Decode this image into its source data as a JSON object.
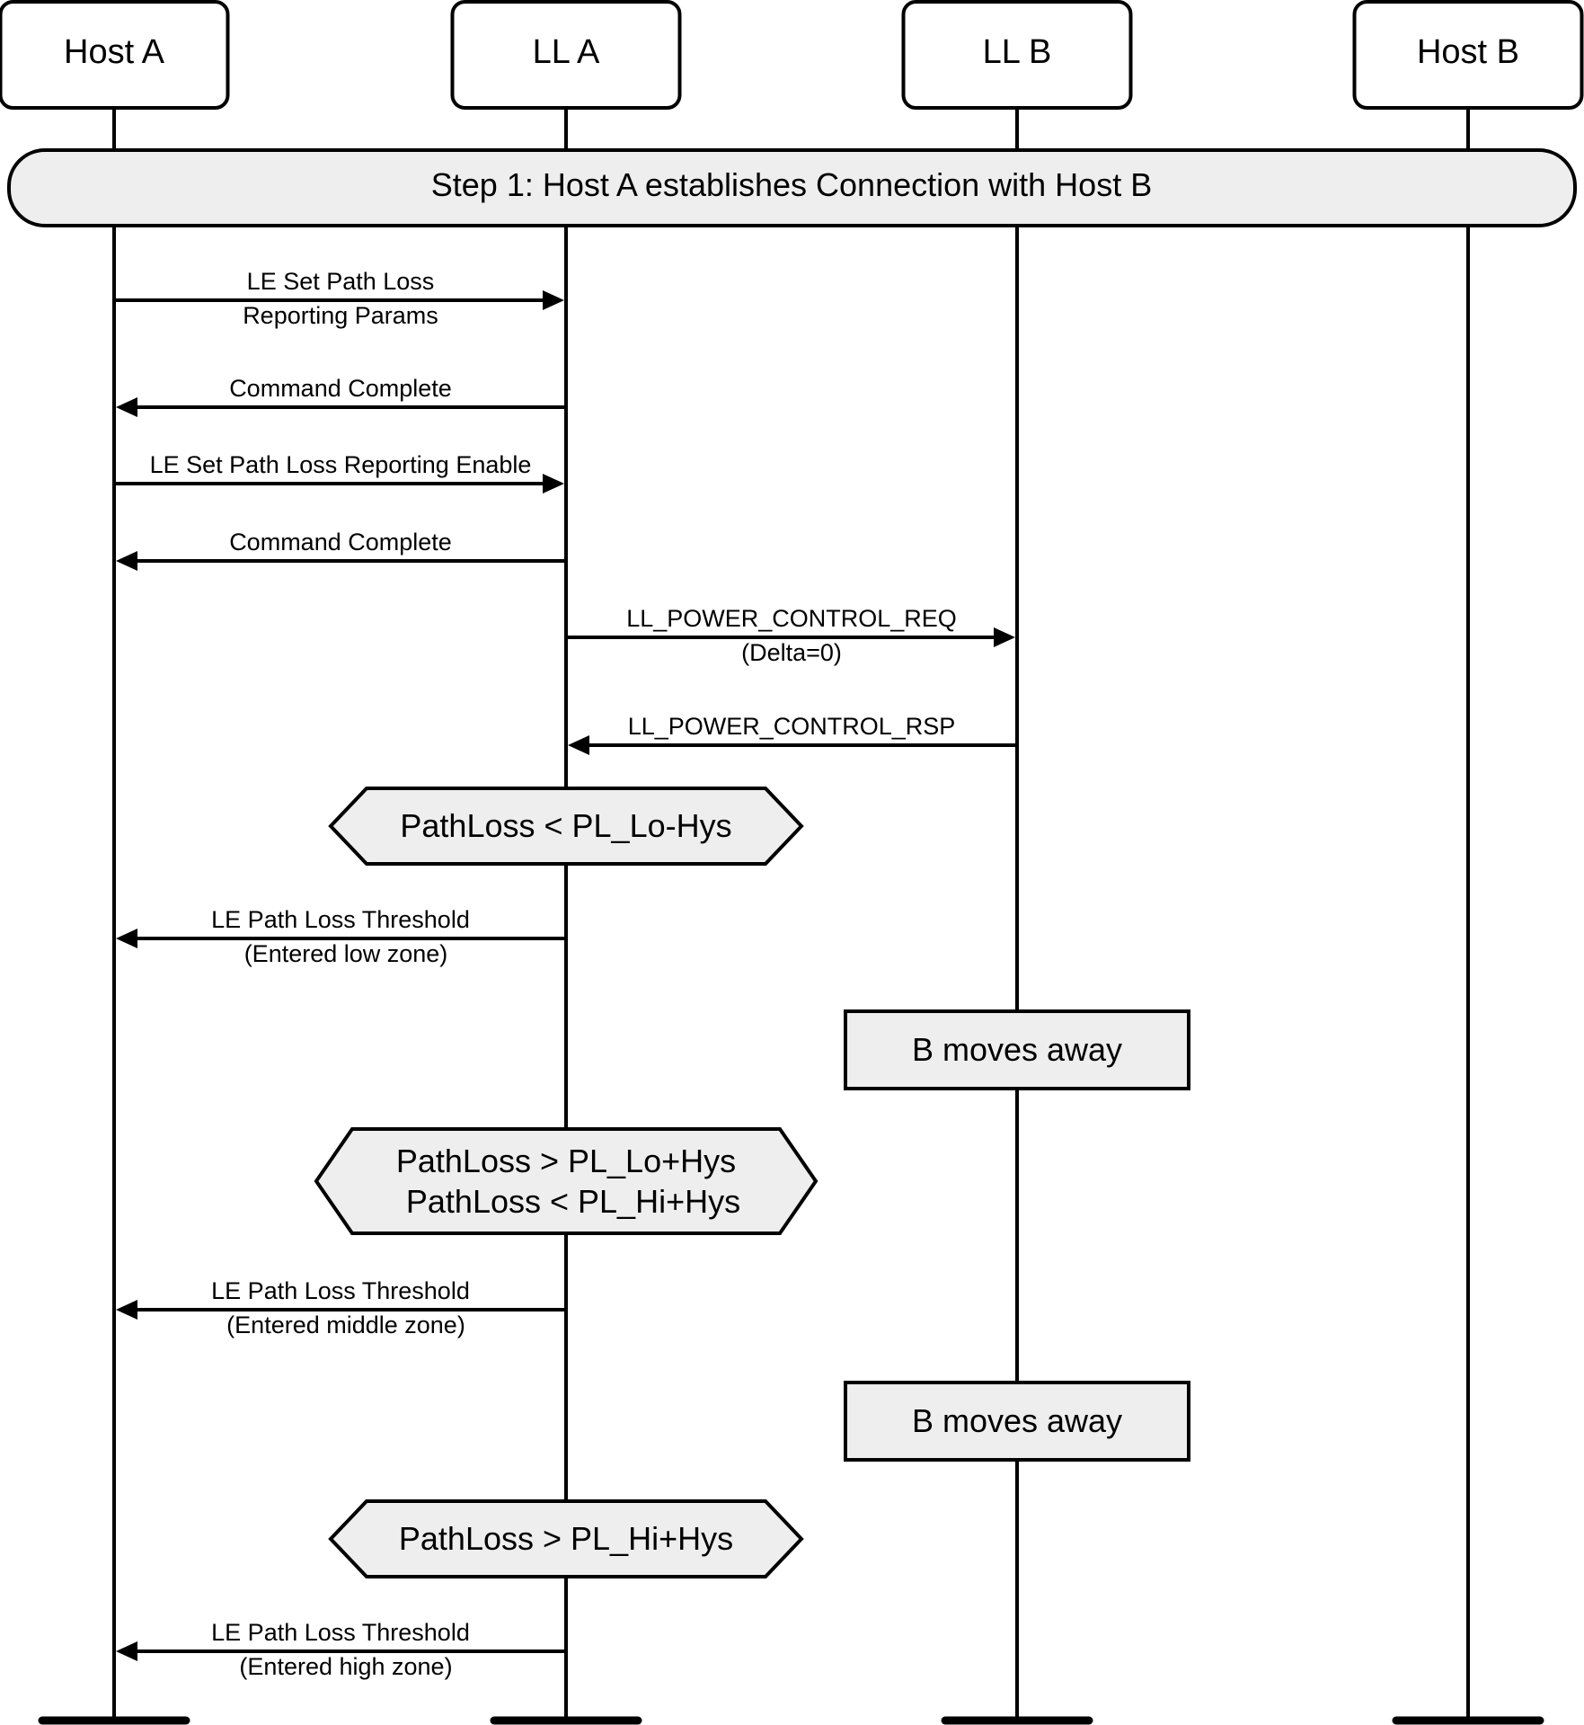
{
  "diagram": {
    "type": "sequence",
    "colors": {
      "line": "#000000",
      "fill_note": "#eeeeee",
      "fill_header": "#ffffff",
      "background": "#ffffff"
    },
    "participants": [
      {
        "id": "hostA",
        "label": "Host A"
      },
      {
        "id": "llA",
        "label": "LL A"
      },
      {
        "id": "llB",
        "label": "LL B"
      },
      {
        "id": "hostB",
        "label": "Host B"
      }
    ],
    "step_bar": {
      "label": "Step 1:  Host A establishes Connection with Host B"
    },
    "events": [
      {
        "kind": "message",
        "from": "hostA",
        "to": "llA",
        "above": "LE Set Path Loss",
        "below": "Reporting Params"
      },
      {
        "kind": "message",
        "from": "llA",
        "to": "hostA",
        "above": "Command Complete",
        "below": ""
      },
      {
        "kind": "message",
        "from": "hostA",
        "to": "llA",
        "above": "LE Set Path Loss Reporting Enable",
        "below": ""
      },
      {
        "kind": "message",
        "from": "llA",
        "to": "hostA",
        "above": "Command Complete",
        "below": ""
      },
      {
        "kind": "message",
        "from": "llA",
        "to": "llB",
        "above": "LL_POWER_CONTROL_REQ",
        "below": "(Delta=0)"
      },
      {
        "kind": "message",
        "from": "llB",
        "to": "llA",
        "above": "LL_POWER_CONTROL_RSP",
        "below": ""
      },
      {
        "kind": "condition",
        "on": "llA",
        "lines": [
          "PathLoss < PL_Lo-Hys"
        ]
      },
      {
        "kind": "message",
        "from": "llA",
        "to": "hostA",
        "above": "LE Path Loss Threshold",
        "below": "(Entered low zone)"
      },
      {
        "kind": "action",
        "on": "llB",
        "label": "B moves away"
      },
      {
        "kind": "condition",
        "on": "llA",
        "lines": [
          "PathLoss > PL_Lo+Hys",
          "PathLoss < PL_Hi+Hys"
        ]
      },
      {
        "kind": "message",
        "from": "llA",
        "to": "hostA",
        "above": "LE Path Loss Threshold",
        "below": "(Entered middle zone)"
      },
      {
        "kind": "action",
        "on": "llB",
        "label": "B moves away"
      },
      {
        "kind": "condition",
        "on": "llA",
        "lines": [
          "PathLoss > PL_Hi+Hys"
        ]
      },
      {
        "kind": "message",
        "from": "llA",
        "to": "hostA",
        "above": "LE Path Loss Threshold",
        "below": "(Entered high zone)"
      }
    ]
  }
}
